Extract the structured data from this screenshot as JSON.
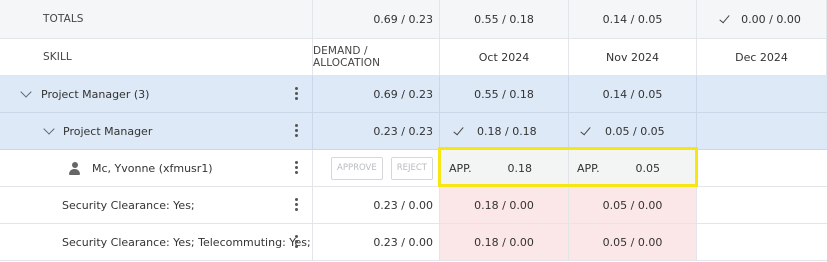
{
  "totals": {
    "label": "TOTALS",
    "demand": "0.69 / 0.23",
    "m1": "0.55 / 0.18",
    "m2": "0.14 / 0.05",
    "m3": "0.00 / 0.00"
  },
  "header": {
    "skill": "SKILL",
    "demand": "DEMAND / ALLOCATION",
    "months": [
      "Oct 2024",
      "Nov 2024",
      "Dec 2024"
    ]
  },
  "rows": [
    {
      "skill": "Project Manager (3)",
      "demand": "0.69 / 0.23",
      "m1": "0.55 / 0.18",
      "m2": "0.14 / 0.05",
      "m3": ""
    },
    {
      "skill": "Project Manager",
      "demand": "0.23 / 0.23",
      "m1": "0.18 / 0.18",
      "m2": "0.05 / 0.05",
      "m3": ""
    },
    {
      "skill": "Mc, Yvonne (xfmusr1)",
      "approve": "APPROVE",
      "reject": "REJECT",
      "m1_status": "APP.",
      "m1": "0.18",
      "m2_status": "APP.",
      "m2": "0.05"
    },
    {
      "skill": "Security Clearance: Yes;",
      "demand": "0.23 / 0.00",
      "m1": "0.18 / 0.00",
      "m2": "0.05 / 0.00",
      "m3": ""
    },
    {
      "skill": "Security Clearance: Yes; Telecommuting: Yes;",
      "demand": "0.23 / 0.00",
      "m1": "0.18 / 0.00",
      "m2": "0.05 / 0.00",
      "m3": ""
    }
  ],
  "colors": {
    "group_row": "#dde9f6",
    "pink_cell": "#fbe7e7",
    "highlight": "#f5e614"
  }
}
